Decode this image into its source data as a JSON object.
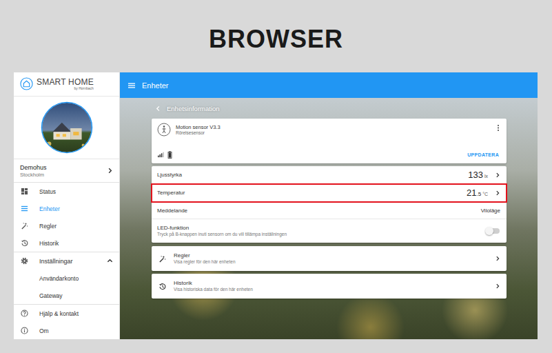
{
  "title": "BROWSER",
  "app": {
    "logo": {
      "name": "SMART HOME",
      "by": "by Hornbach"
    }
  },
  "sidebar": {
    "home": {
      "name": "Demohus",
      "city": "Stockholm"
    },
    "sections": [
      [
        {
          "label": "Status",
          "selected": false,
          "kind": "item"
        },
        {
          "label": "Enheter",
          "selected": true,
          "kind": "item"
        },
        {
          "label": "Regler",
          "selected": false,
          "kind": "item"
        },
        {
          "label": "Historik",
          "selected": false,
          "kind": "item"
        }
      ],
      [
        {
          "label": "Inställningar",
          "selected": false,
          "kind": "group",
          "expanded": true
        },
        {
          "label": "Användarkonto",
          "selected": false,
          "kind": "sub"
        },
        {
          "label": "Gateway",
          "selected": false,
          "kind": "sub"
        }
      ],
      [
        {
          "label": "Hjälp & kontakt",
          "selected": false,
          "kind": "item"
        },
        {
          "label": "Om",
          "selected": false,
          "kind": "item"
        }
      ]
    ]
  },
  "toolbar": {
    "title": "Enheter"
  },
  "back": {
    "label": "Enhetsinformation"
  },
  "device": {
    "name": "Motion sensor V3.3",
    "type": "Rörelsesensor",
    "signal": {
      "level": 0.75
    },
    "battery": {
      "level": 1
    },
    "button": "UPPDATERA"
  },
  "rows": [
    {
      "kind": "value",
      "label": "Ljusstyrka",
      "value": "133",
      "decimals": "",
      "unit": "lx",
      "highlighted": false
    },
    {
      "kind": "value",
      "label": "Temperatur",
      "value": "21",
      "decimals": ".5",
      "unit": "°C",
      "highlighted": true
    },
    {
      "kind": "text",
      "label": "Meddelande",
      "value": "Viloläge",
      "highlighted": false
    },
    {
      "kind": "toggle",
      "label": "LED-funktion",
      "hint": "Tryck på B-knappen inuti sensorn om du vill tillämpa inställningen",
      "on": false,
      "highlighted": false
    }
  ],
  "links": [
    {
      "title": "Regler",
      "subtitle": "Visa regler för den här enheten"
    },
    {
      "title": "Historik",
      "subtitle": "Visa historiska data för den här enheten"
    }
  ]
}
